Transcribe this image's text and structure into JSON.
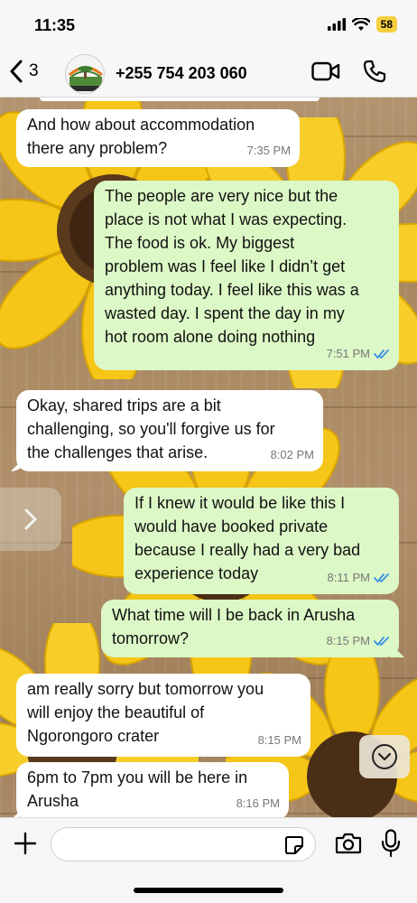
{
  "status_bar": {
    "time": "11:35",
    "battery": "58"
  },
  "header": {
    "back_count": "3",
    "contact_name": "+255 754 203 060"
  },
  "messages": [
    {
      "direction": "in",
      "text": "And how about accommodation\nthere any problem?",
      "time": "7:35 PM"
    },
    {
      "direction": "out",
      "text": "The people are very nice but the\nplace is not what I was expecting.\nThe food is ok. My biggest\nproblem was I feel like I didn’t get\nanything today. I feel like this was a\nwasted day. I spent the day in my\nhot room alone doing nothing",
      "time": "7:51 PM",
      "read": true
    },
    {
      "direction": "in",
      "text": "Okay, shared trips are a bit\nchallenging, so you'll forgive us for\nthe challenges that arise.",
      "time": "8:02 PM"
    },
    {
      "direction": "out",
      "text": "If I knew it would be like this I\nwould have booked private\nbecause I really had a very bad\nexperience today",
      "time": "8:11 PM",
      "read": true
    },
    {
      "direction": "out",
      "text": "What time will I be back in Arusha\ntomorrow?",
      "time": "8:15 PM",
      "read": true
    },
    {
      "direction": "in",
      "text": "am really sorry but tomorrow you\nwill enjoy the beautiful of\nNgorongoro crater",
      "time": "8:15 PM"
    },
    {
      "direction": "in",
      "text": "6pm to 7pm you will be here in\nArusha",
      "time": "8:16 PM"
    }
  ],
  "input": {
    "placeholder": ""
  },
  "icons": {
    "back": "chevron-left-icon",
    "video": "video-camera-icon",
    "call": "phone-icon",
    "plus": "plus-icon",
    "sticker": "sticker-icon",
    "camera": "camera-icon",
    "mic": "microphone-icon",
    "scroll_down": "chevron-down-icon",
    "read_receipt": "double-check-icon"
  },
  "colors": {
    "incoming_bubble": "#ffffff",
    "outgoing_bubble": "#dcf8c6",
    "read_tick": "#3a8ee6",
    "battery": "#f4d03f"
  }
}
